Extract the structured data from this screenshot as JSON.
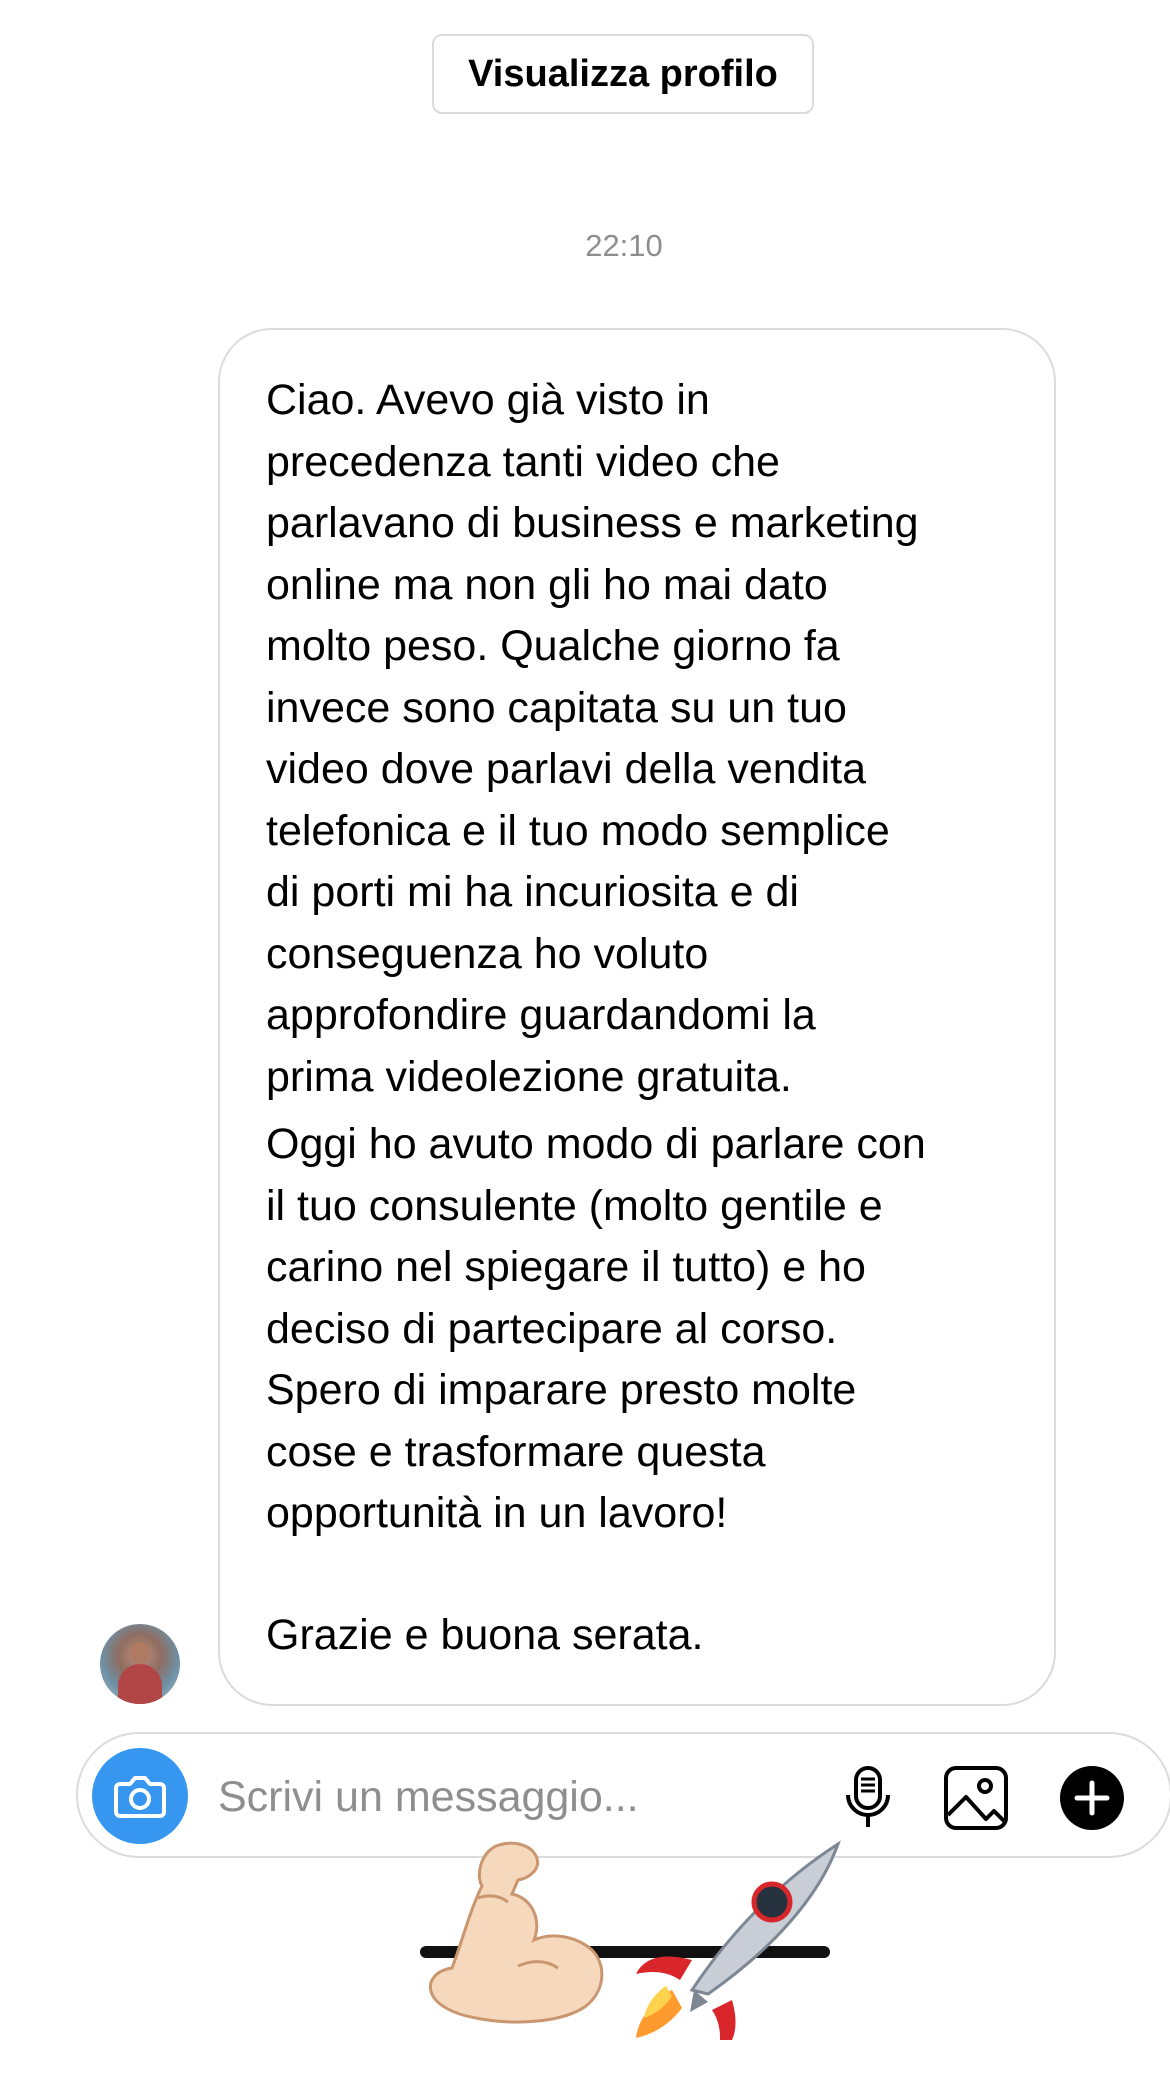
{
  "header": {
    "view_profile_label": "Visualizza profilo"
  },
  "thread": {
    "timestamp": "22:10",
    "message": {
      "paragraphs": [
        "Ciao. Avevo già visto in\nprecedenza tanti video che\nparlavano di business e marketing\nonline ma non gli ho mai dato\nmolto peso. Qualche giorno fa\ninvece sono capitata su un tuo\nvideo dove parlavi della vendita\ntelefonica e il tuo modo semplice\ndi porti mi ha incuriosita e di\nconseguenza ho voluto\napprofondire guardandomi la\nprima videolezione gratuita.",
        "Oggi ho avuto modo di parlare con\nil tuo consulente (molto gentile e\ncarino nel spiegare il tutto) e ho\ndeciso di partecipare al corso.\nSpero di imparare presto molte\ncose e trasformare questa\nopportunità in un lavoro!",
        "Grazie e buona serata."
      ]
    }
  },
  "composer": {
    "placeholder": "Scrivi un messaggio...",
    "value": "",
    "camera_icon": "camera-icon",
    "mic_icon": "microphone-icon",
    "gallery_icon": "image-icon",
    "plus_icon": "plus-icon"
  },
  "decorations": {
    "emojis": [
      "flexed-biceps-emoji",
      "rocket-emoji"
    ]
  },
  "colors": {
    "accent": "#3797f0",
    "border": "#dbdbdb",
    "muted_text": "#8e8e8e"
  }
}
